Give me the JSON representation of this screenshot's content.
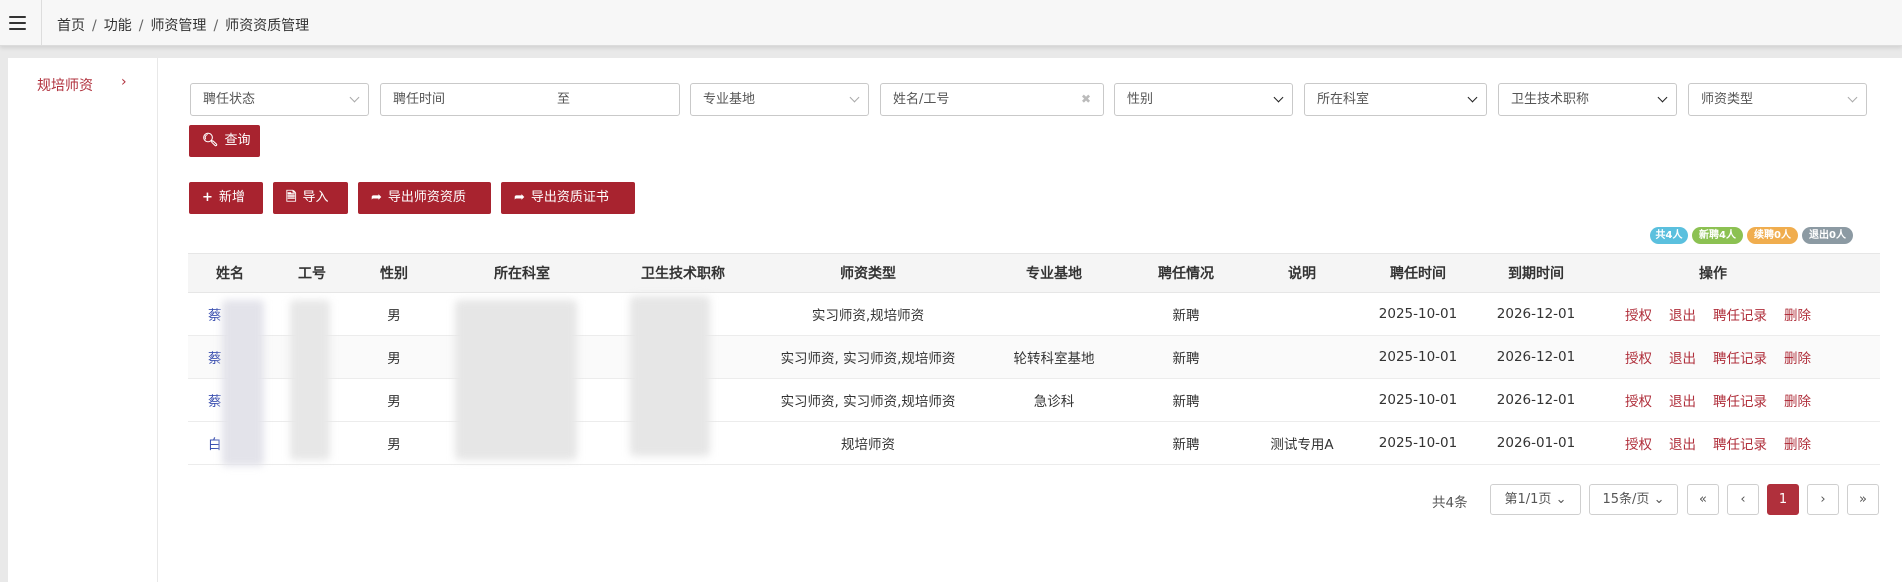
{
  "breadcrumb": [
    "首页",
    "功能",
    "师资管理",
    "师资资质管理"
  ],
  "sidebar": {
    "items": [
      {
        "label": "规培师资",
        "arrow": "›"
      }
    ]
  },
  "filters": {
    "status": "聘任状态",
    "time_label": "聘任时间",
    "time_to": "至",
    "base": "专业基地",
    "name_placeholder": "姓名/工号",
    "clear_icon": "✖",
    "gender": "性别",
    "dept": "所在科室",
    "title": "卫生技术职称",
    "type": "师资类型"
  },
  "actions": {
    "query": "查询",
    "add": "新增",
    "import": "导入",
    "export_qual": "导出师资资质",
    "export_cert": "导出资质证书"
  },
  "badges": [
    {
      "label": "共4人",
      "color": "#5bc0de"
    },
    {
      "label": "新聘4人",
      "color": "#8cc152"
    },
    {
      "label": "续聘0人",
      "color": "#f0ad4e"
    },
    {
      "label": "退出0人",
      "color": "#8c9aa3"
    }
  ],
  "table": {
    "headers": [
      "姓名",
      "工号",
      "性别",
      "所在科室",
      "卫生技术职称",
      "师资类型",
      "专业基地",
      "聘任情况",
      "说明",
      "聘任时间",
      "到期时间",
      "操作"
    ],
    "rows": [
      {
        "name": "蔡",
        "gender": "男",
        "type": "实习师资,规培师资",
        "base": "",
        "status": "新聘",
        "note": "",
        "start": "2025-10-01",
        "end": "2026-12-01"
      },
      {
        "name": "蔡",
        "gender": "男",
        "type": "实习师资, 实习师资,规培师资",
        "base": "轮转科室基地",
        "status": "新聘",
        "note": "",
        "start": "2025-10-01",
        "end": "2026-12-01"
      },
      {
        "name": "蔡",
        "gender": "男",
        "type": "实习师资, 实习师资,规培师资",
        "base": "急诊科",
        "status": "新聘",
        "note": "",
        "start": "2025-10-01",
        "end": "2026-12-01"
      },
      {
        "name": "白",
        "gender": "男",
        "type": "规培师资",
        "base": "",
        "status": "新聘",
        "note": "测试专用A",
        "start": "2025-10-01",
        "end": "2026-01-01"
      }
    ],
    "ops": [
      "授权",
      "退出",
      "聘任记录",
      "删除"
    ]
  },
  "pagination": {
    "total": "共4条",
    "page_select": "第1/1页",
    "size_select": "15条/页",
    "first": "«",
    "prev": "‹",
    "current": "1",
    "next": "›",
    "last": "»"
  },
  "colors": {
    "accent": "#a8232f",
    "link": "#3a4fb0"
  }
}
